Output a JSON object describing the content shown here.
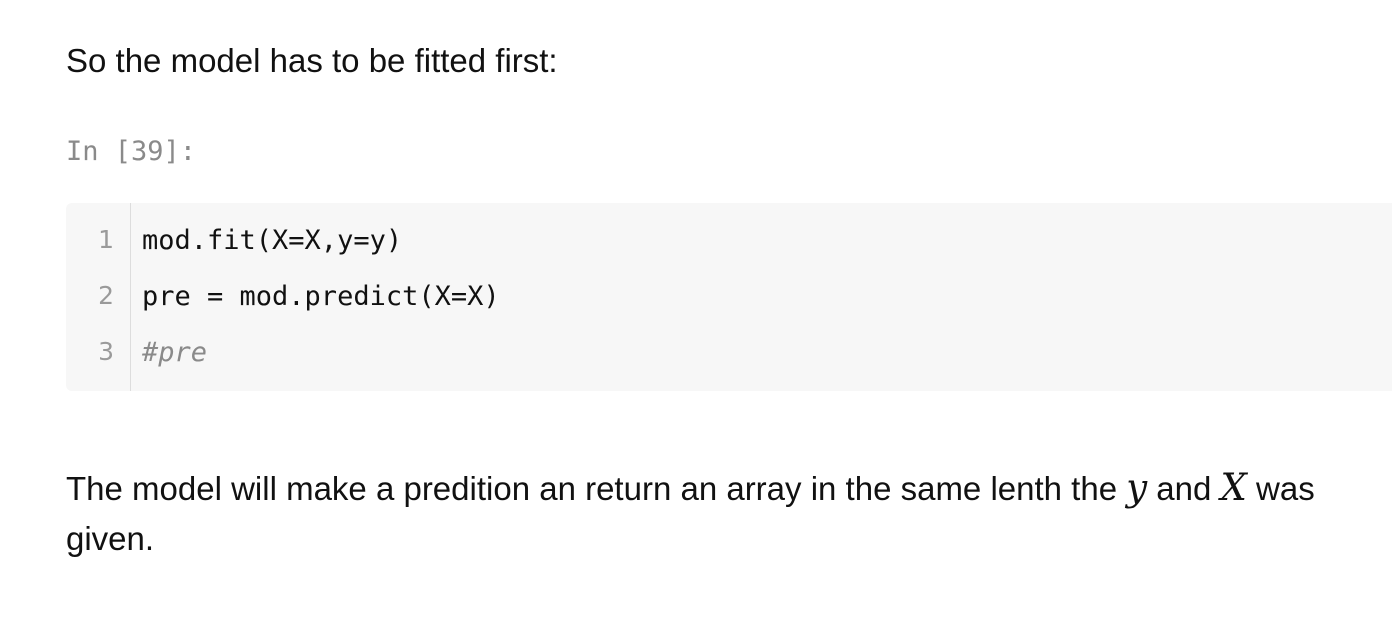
{
  "intro": {
    "text": "So the model has to be fitted first:"
  },
  "cell": {
    "prompt": "In [39]:",
    "lines": [
      {
        "number": "1",
        "code": "mod.fit(X=X,y=y)"
      },
      {
        "number": "2",
        "code": "pre = mod.predict(X=X)"
      },
      {
        "number": "3",
        "code": "#pre"
      }
    ]
  },
  "outro": {
    "part1": "The model will make a predition an return an array in the same lenth the ",
    "var_y": "y",
    "part2": " and ",
    "var_X": "X",
    "part3": " was given."
  },
  "colors": {
    "code_background": "#f7f7f7",
    "prompt": "#8a8a8a",
    "comment": "#8a8a8a"
  }
}
